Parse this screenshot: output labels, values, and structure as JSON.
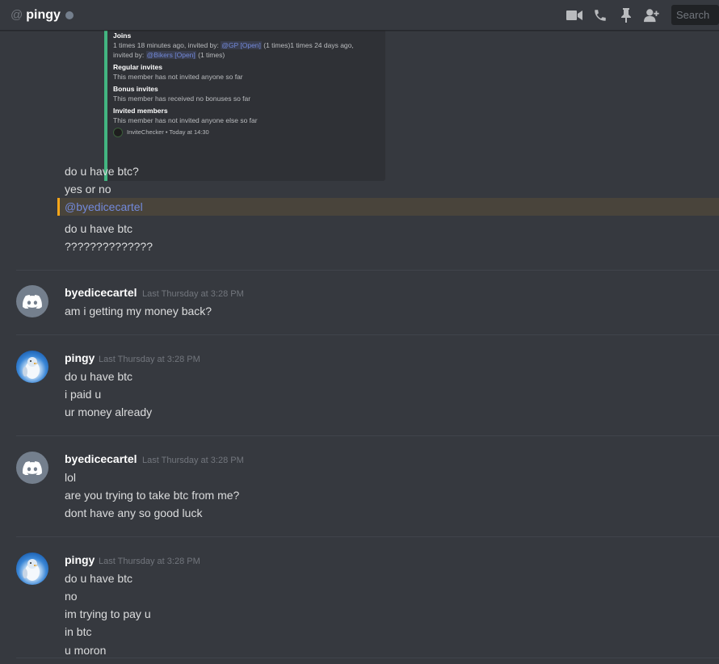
{
  "header": {
    "at_symbol": "@",
    "name": "pingy",
    "search_placeholder": "Search"
  },
  "embed": {
    "joins_title": "Joins",
    "joins_line1_pre": "1 times 18 minutes ago, invited by: ",
    "joins_mention1": "@GP [Open]",
    "joins_line1_post": " (1 times)1 times 24 days ago,",
    "joins_line2_pre": "invited by: ",
    "joins_mention2": "@Bikers [Open]",
    "joins_line2_post": " (1 times)",
    "regular_title": "Regular invites",
    "regular_value": "This member has not invited anyone so far",
    "bonus_title": "Bonus invites",
    "bonus_value": "This member has received no bonuses so far",
    "invited_title": "Invited members",
    "invited_value": "This member has not invited anyone else so far",
    "footer_text": "InviteChecker • Today at 14:30"
  },
  "top_lines": [
    "do u have btc?",
    "yes or no"
  ],
  "mention_line": "@byedicecartel",
  "top_lines2": [
    "do u have btc",
    "??????????????"
  ],
  "messages": [
    {
      "author": "byedicecartel",
      "timestamp": "Last Thursday at 3:28 PM",
      "lines": [
        "am i getting my money back?"
      ]
    },
    {
      "author": "pingy",
      "timestamp": "Last Thursday at 3:28 PM",
      "lines": [
        "do u have btc",
        "i paid u",
        "ur money already"
      ]
    },
    {
      "author": "byedicecartel",
      "timestamp": "Last Thursday at 3:28 PM",
      "lines": [
        "lol",
        "are you trying to take btc from me?",
        "dont have any so good luck"
      ]
    },
    {
      "author": "pingy",
      "timestamp": "Last Thursday at 3:28 PM",
      "lines": [
        "do u have btc",
        "no",
        "im trying to pay u",
        "in btc",
        "u moron"
      ]
    }
  ],
  "colors": {
    "background": "#36393f",
    "mention": "#7289da",
    "mention_highlight": "#faa61a",
    "embed_bar": "#43b581"
  }
}
